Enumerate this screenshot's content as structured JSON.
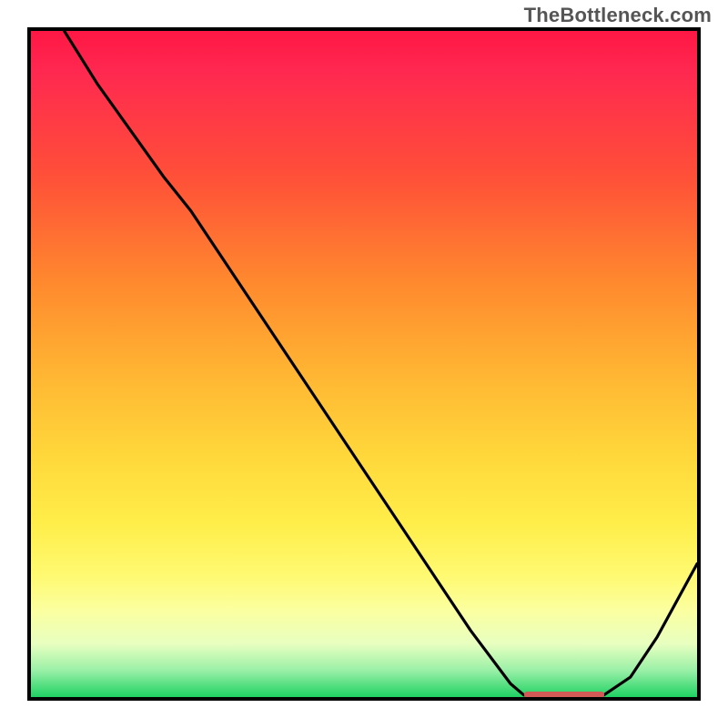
{
  "watermark": "TheBottleneck.com",
  "chart_data": {
    "type": "line",
    "title": "",
    "xlabel": "",
    "ylabel": "",
    "xlim": [
      0,
      100
    ],
    "ylim": [
      0,
      100
    ],
    "series": [
      {
        "name": "curve",
        "x": [
          5,
          10,
          15,
          20,
          24,
          30,
          36,
          42,
          48,
          54,
          60,
          66,
          72,
          74,
          78,
          82,
          86,
          90,
          94,
          100
        ],
        "y": [
          100,
          92,
          85,
          78,
          73,
          64,
          55,
          46,
          37,
          28,
          19,
          10,
          2,
          0.3,
          0.0,
          0.0,
          0.3,
          3,
          9,
          20
        ]
      }
    ],
    "marker": {
      "x_start": 74,
      "x_end": 86,
      "y": 0.3,
      "color": "#d15a56"
    },
    "gradient_stops": [
      {
        "pos": 0.0,
        "color": "#ff1744"
      },
      {
        "pos": 0.06,
        "color": "#ff2850"
      },
      {
        "pos": 0.22,
        "color": "#ff5038"
      },
      {
        "pos": 0.38,
        "color": "#ff8a2e"
      },
      {
        "pos": 0.52,
        "color": "#ffb733"
      },
      {
        "pos": 0.64,
        "color": "#ffd83b"
      },
      {
        "pos": 0.74,
        "color": "#ffee4a"
      },
      {
        "pos": 0.82,
        "color": "#fffa73"
      },
      {
        "pos": 0.87,
        "color": "#fbffa0"
      },
      {
        "pos": 0.92,
        "color": "#e8ffc0"
      },
      {
        "pos": 0.96,
        "color": "#9af0a7"
      },
      {
        "pos": 1.0,
        "color": "#1fd163"
      }
    ]
  }
}
